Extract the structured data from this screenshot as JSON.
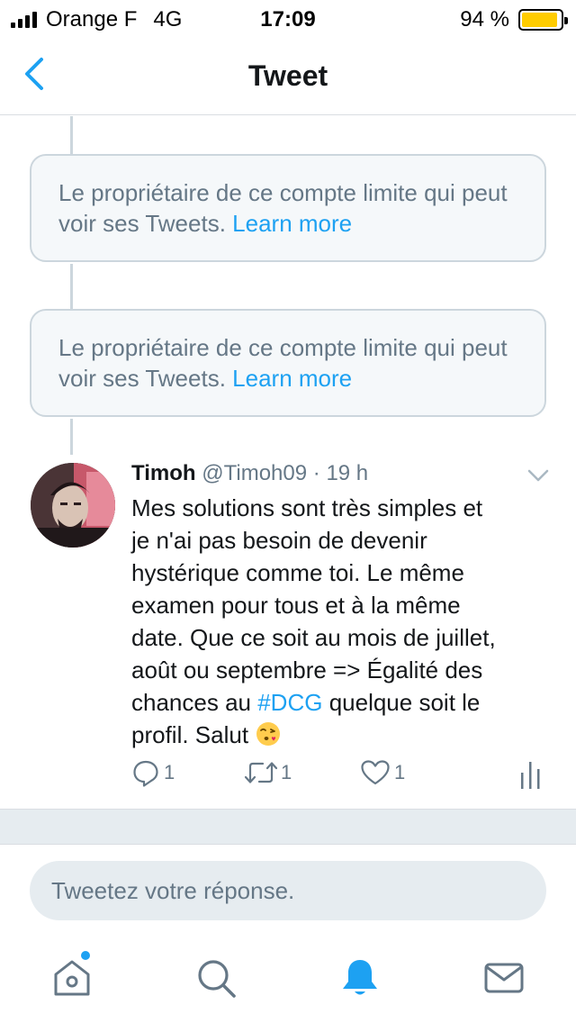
{
  "status_bar": {
    "carrier": "Orange F",
    "network": "4G",
    "time": "17:09",
    "battery": "94 %",
    "battery_level": 0.94,
    "battery_color": "#ffcc00"
  },
  "nav": {
    "title": "Tweet",
    "back_icon": "chevron-left-icon"
  },
  "notices": [
    {
      "text": "Le propriétaire de ce compte limite qui peut voir ses Tweets. ",
      "link": "Learn more"
    },
    {
      "text": "Le propriétaire de ce compte limite qui peut voir ses Tweets. ",
      "link": "Learn more"
    }
  ],
  "tweet": {
    "name": "Timoh",
    "handle": "@Timoh09",
    "separator": "·",
    "age": "19 h",
    "lines": [
      "Mes solutions sont très simples et",
      "je n'ai pas besoin de devenir",
      "hystérique comme toi. Le même",
      "examen pour tous et à la même",
      "date. Que ce soit au mois de juillet,",
      "août ou septembre => Égalité des"
    ],
    "line7_before": "chances au ",
    "hashtag": "#DCG",
    "line7_after": " quelque soit le",
    "line8": "profil. Salut ",
    "emoji": "face-throwing-kiss-icon",
    "replies": "1",
    "retweets": "1",
    "likes": "1"
  },
  "reply": {
    "placeholder": "Tweetez votre réponse."
  },
  "tabs": [
    "home-icon",
    "search-icon",
    "notifications-icon",
    "messages-icon"
  ],
  "colors": {
    "accent": "#1da1f2",
    "muted": "#657786",
    "border": "#ccd6dd",
    "notice_bg": "#f5f8fa"
  }
}
